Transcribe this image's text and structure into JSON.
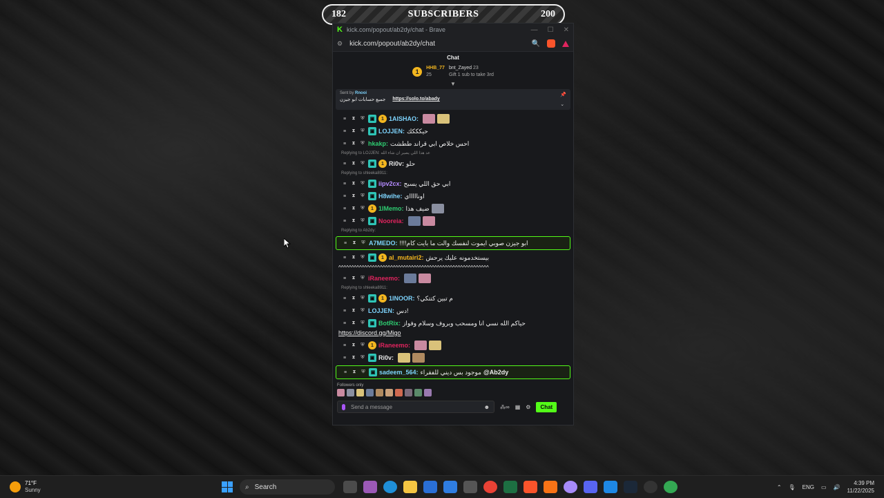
{
  "subscribers": {
    "current": "182",
    "label": "SUBSCRIBERS",
    "goal": "200"
  },
  "window": {
    "title": "kick.com/popout/ab2dy/chat - Brave",
    "url": "kick.com/popout/ab2dy/chat"
  },
  "chat": {
    "header": "Chat",
    "leaderboard": {
      "first": {
        "name": "HHB_77",
        "count": "25"
      },
      "second": {
        "name": "bnt_Zayed",
        "count": "23"
      },
      "gift_prompt": "Gift 1 sub to take 3rd"
    },
    "pinned": {
      "sent_by_label": "Sent by",
      "sender": "Rnooi",
      "text": "جميع حسابات ابو جيزن",
      "link": "https://solo.to/abady"
    },
    "messages": [
      {
        "user": "1AISHAO:",
        "color": "#7dd3fc",
        "text": ""
      },
      {
        "user": "LOJJEN:",
        "color": "#7dd3fc",
        "text": "حيكككك"
      },
      {
        "user": "hkakp:",
        "color": "#2ecc71",
        "text": "احس خلاص ابي قراند ططشت"
      },
      {
        "reply": "Replying to LOJJEN: عد هذا اللي يصير ان شاء الله"
      },
      {
        "user": "Ri0v:",
        "color": "#e6e6e6",
        "text": "حلو"
      },
      {
        "reply": "Replying to shleeka8911:"
      },
      {
        "user": "iipv2cx:",
        "color": "#b48bff",
        "text": "ابي حق اللي يسبح"
      },
      {
        "user": "H8wihe:",
        "color": "#7dd3fc",
        "text": "اوناااااي"
      },
      {
        "user": "1IMemo:",
        "color": "#2ecc71",
        "text": "ضيف هذا"
      },
      {
        "user": "Nooreia:",
        "color": "#e0245e",
        "text": ""
      },
      {
        "reply": "Replying to Ab2dy:"
      },
      {
        "user": "A7MEDO:",
        "color": "#7dd3fc",
        "text": "!!!!ابو جيزن صوبي ايموت لنفسك والت ما بايت كام",
        "highlight": true
      },
      {
        "user": "al_mutairi2:",
        "color": "#f3b61f",
        "text": "بيستخدمونه عليك يرحش"
      },
      {
        "plain": "^^^^^^^^^^^^^^^^^^^^^^^^^^^^^^^^^^^^^^^^^^^^^^^^^^^^^^^^^^"
      },
      {
        "user": "iRaneemo:",
        "color": "#e0245e",
        "text": ""
      },
      {
        "reply": "Replying to shleeka8911:"
      },
      {
        "user": "1INOOR:",
        "color": "#7dd3fc",
        "text": "م تبين كتتكي؟"
      },
      {
        "user": "LOJJEN:",
        "color": "#7dd3fc",
        "text": "دس!"
      },
      {
        "user": "BotRix:",
        "color": "#2ecc71",
        "text": "حياكم الله نسي انا ومسحب وبروف وسلام وفواز"
      },
      {
        "link": "https://discord.gg/Migo"
      },
      {
        "user": "iRaneemo:",
        "color": "#e0245e",
        "text": ""
      },
      {
        "user": "Ri0v:",
        "color": "#e6e6e6",
        "text": ""
      },
      {
        "user": "sadeem_564:",
        "color": "#7dd3fc",
        "text": "موجود بس ديني للفقراء",
        "mention": "@Ab2dy",
        "highlight": true
      }
    ],
    "followers_only": "Followers only",
    "input_placeholder": "Send a message",
    "chat_button": "Chat"
  },
  "taskbar": {
    "weather_temp": "71°F",
    "weather_desc": "Sunny",
    "search": "Search",
    "lang": "ENG",
    "time": "4:39 PM",
    "date": "11/22/2025"
  }
}
